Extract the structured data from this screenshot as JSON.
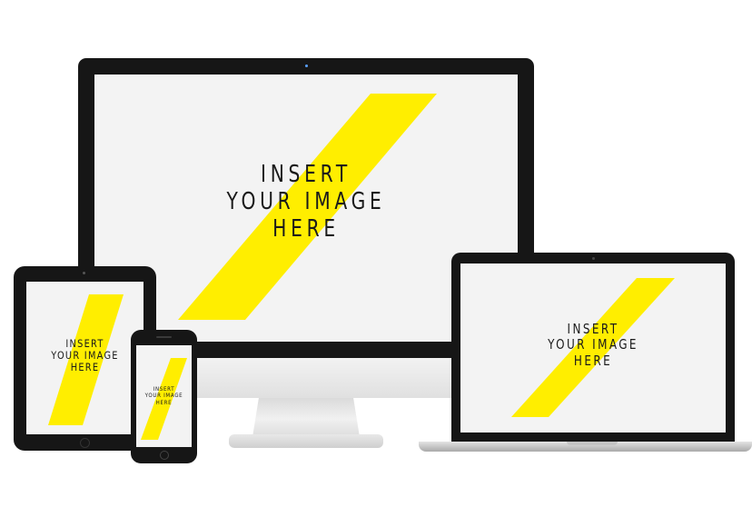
{
  "colors": {
    "frame": "#161616",
    "screen": "#f3f3f3",
    "accent": "#ffee00",
    "stand": "#e6e6e6"
  },
  "devices": {
    "desktop": {
      "placeholder": [
        "INSERT",
        "YOUR IMAGE",
        "HERE"
      ]
    },
    "laptop": {
      "placeholder": [
        "INSERT",
        "YOUR IMAGE",
        "HERE"
      ]
    },
    "tablet": {
      "placeholder": [
        "INSERT",
        "YOUR IMAGE",
        "HERE"
      ]
    },
    "phone": {
      "placeholder": [
        "INSERT",
        "YOUR IMAGE",
        "HERE"
      ]
    }
  }
}
